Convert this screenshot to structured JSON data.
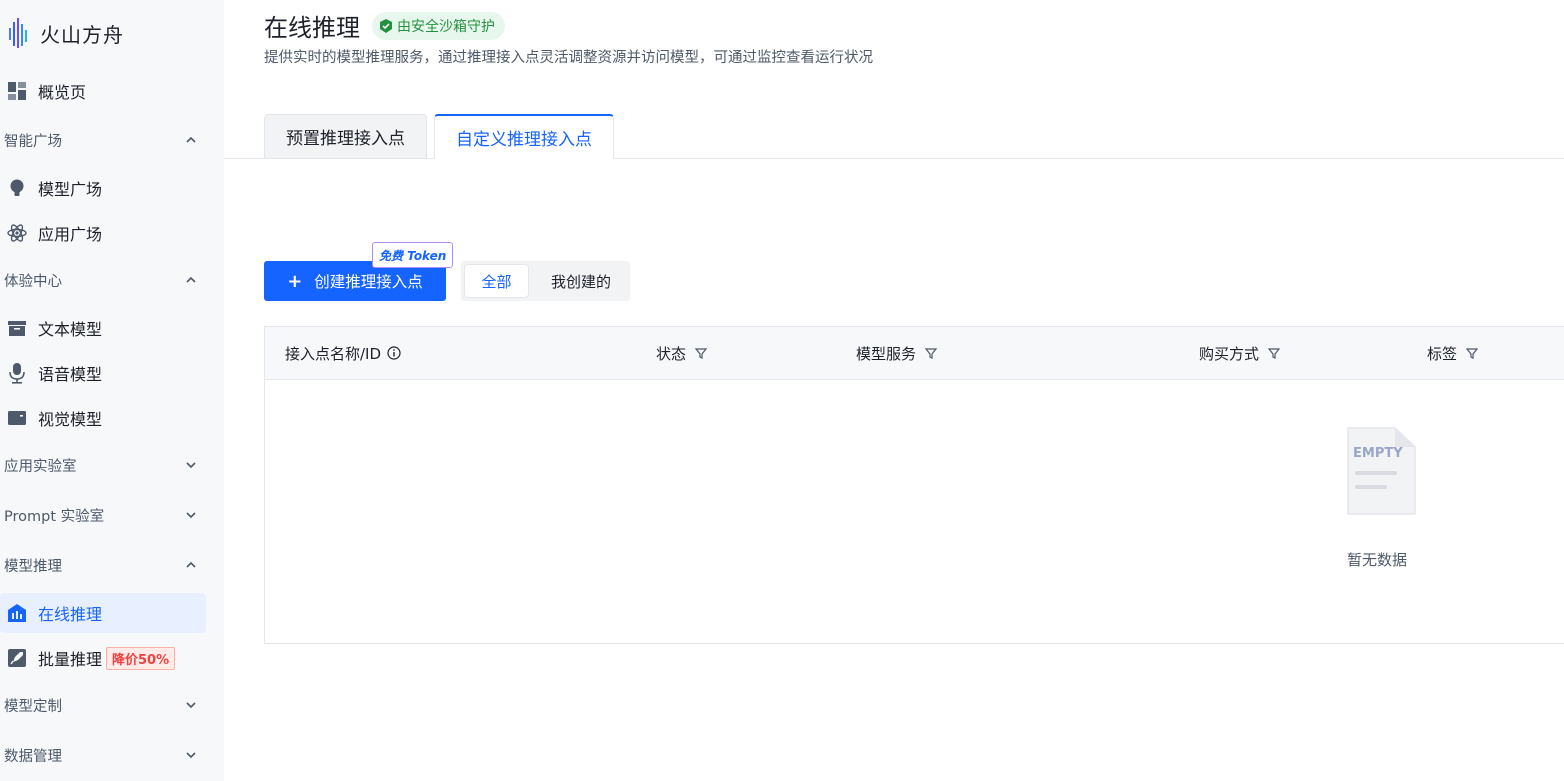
{
  "app": {
    "name": "火山方舟"
  },
  "sidebar": {
    "overview": "概览页",
    "groups": {
      "smart_plaza": "智能广场",
      "experience": "体验中心",
      "app_lab": "应用实验室",
      "prompt_lab": "Prompt 实验室",
      "inference": "模型推理",
      "customize": "模型定制",
      "data": "数据管理"
    },
    "items": {
      "model_plaza": "模型广场",
      "app_plaza": "应用广场",
      "text_model": "文本模型",
      "voice_model": "语音模型",
      "vision_model": "视觉模型",
      "online_inference": "在线推理",
      "batch_inference": "批量推理",
      "batch_badge": "降价50%"
    }
  },
  "page": {
    "title": "在线推理",
    "badge": "由安全沙箱守护",
    "description": "提供实时的模型推理服务，通过推理接入点灵活调整资源并访问模型，可通过监控查看运行状况"
  },
  "tabs": {
    "preset": "预置推理接入点",
    "custom": "自定义推理接入点"
  },
  "toolbar": {
    "create_label": "创建推理接入点",
    "free_token": "免费 Token",
    "filter_all": "全部",
    "filter_mine": "我创建的"
  },
  "table": {
    "columns": {
      "name": "接入点名称/ID",
      "status": "状态",
      "service": "模型服务",
      "purchase": "购买方式",
      "tags": "标签"
    },
    "empty_icon_text": "EMPTY",
    "empty_text": "暂无数据"
  },
  "colors": {
    "primary": "#1664ff",
    "active_bg": "#e8f0ff",
    "badge_green": "#23923f",
    "discount_red": "#f53f3f"
  }
}
